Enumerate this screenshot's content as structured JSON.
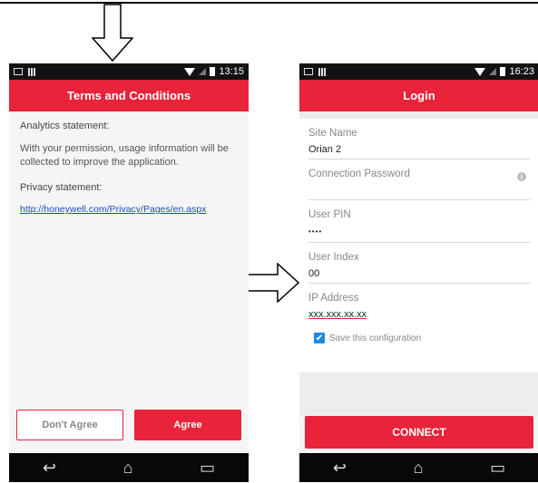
{
  "left_phone": {
    "status": {
      "time": "13:15"
    },
    "title": "Terms and Conditions",
    "analytics_heading": "Analytics statement:",
    "analytics_text": "With your permission, usage information will be collected to improve the application.",
    "privacy_heading": "Privacy statement:",
    "privacy_link": "http://honeywell.com/Privacy/Pages/en.aspx",
    "disagree_label": "Don't Agree",
    "agree_label": "Agree"
  },
  "right_phone": {
    "status": {
      "time": "16:23"
    },
    "title": "Login",
    "fields": [
      {
        "label": "Site Name",
        "value": "Orian 2"
      },
      {
        "label": "Connection Password",
        "value": ""
      },
      {
        "label": "User PIN",
        "value": "••••"
      },
      {
        "label": "User Index",
        "value": "00"
      },
      {
        "label": "IP Address",
        "value": "xxx.xxx.xx.xx"
      }
    ],
    "save_label": "Save this configuration",
    "save_checked": true,
    "connect_label": "CONNECT"
  },
  "colors": {
    "accent": "#e8233a",
    "checkbox": "#1e88e5"
  },
  "icons": [
    "image-icon",
    "sim-icon",
    "wifi-icon",
    "signal-icon",
    "battery-icon",
    "info-icon",
    "back-icon",
    "home-icon",
    "recents-icon",
    "down-arrow-icon",
    "right-arrow-icon",
    "checkbox-icon"
  ]
}
